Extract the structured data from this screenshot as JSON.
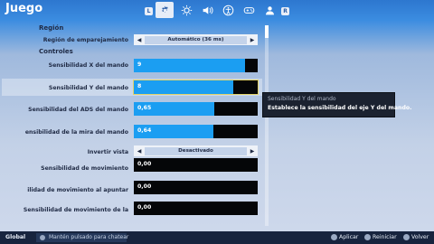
{
  "header": {
    "title": "Juego",
    "left_badge": "L",
    "right_badge": "R",
    "tabs": [
      {
        "icon": "gear-icon",
        "active": true
      },
      {
        "icon": "brightness-icon"
      },
      {
        "icon": "speaker-icon"
      },
      {
        "icon": "accessibility-icon"
      },
      {
        "icon": "gamepad-icon"
      },
      {
        "icon": "user-icon"
      }
    ]
  },
  "sections": {
    "region": "Región",
    "controls": "Controles"
  },
  "settings": {
    "matchmaking_label": "Región de emparejamiento",
    "matchmaking_value": "Automático (36 ms)",
    "sens_x_label": "Sensibilidad X del mando",
    "sens_x_value": "9",
    "sens_x_fill": 0.9,
    "sens_y_label": "Sensibilidad Y del mando",
    "sens_y_value": "8",
    "sens_y_fill": 0.8,
    "ads_label": "Sensibilidad del ADS del mando",
    "ads_value": "0,65",
    "ads_fill": 0.65,
    "scope_label": "ensibilidad de la mira del mando",
    "scope_value": "0,64",
    "scope_fill": 0.64,
    "invert_label": "Invertir vista",
    "invert_value": "Desactivado",
    "motion_label": "Sensibilidad de movimiento",
    "motion_value": "0,00",
    "motion_aim_label": "ilidad de movimiento al apuntar",
    "motion_aim_value": "0,00",
    "motion_scope_label": "Sensibilidad de movimiento de la",
    "motion_scope_value": "0,00"
  },
  "tooltip": {
    "title": "Sensibilidad Y del mando",
    "text": "Establece la sensibilidad del eje Y del mando."
  },
  "footer": {
    "scope": "Global",
    "chat_hint": "Mantén pulsado para chatear",
    "apply": "Aplicar",
    "reset": "Reiniciar",
    "back": "Volver"
  },
  "colors": {
    "accent": "#1b9ef2",
    "highlight_border": "#e3d36a"
  }
}
